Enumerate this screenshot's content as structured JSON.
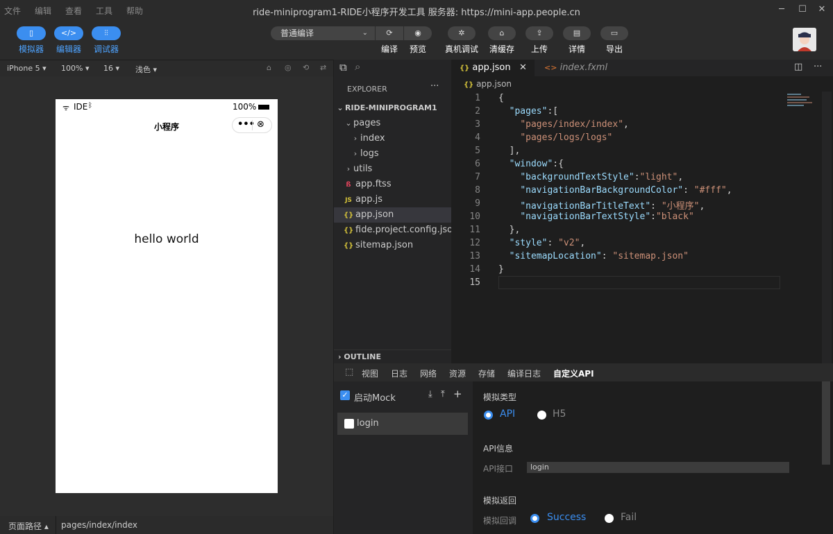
{
  "menu": [
    "文件",
    "编辑",
    "查看",
    "工具",
    "帮助"
  ],
  "window_title": "ride-miniprogram1-RIDE小程序开发工具 服务器: https://mini-app.people.cn",
  "toolbar": {
    "modes": [
      "模拟器",
      "编辑器",
      "调试器"
    ],
    "compile_mode": "普通编译",
    "compile_label": "编译",
    "preview_label": "预览",
    "actions": [
      "真机调试",
      "清缓存",
      "上传",
      "详情",
      "导出"
    ]
  },
  "simulator": {
    "device": "iPhone 5",
    "zoom": "100%",
    "font_size": "16",
    "theme": "浅色",
    "status_left": "IDE",
    "status_right": "100%",
    "nav_title": "小程序",
    "content": "hello world",
    "footer_label": "页面路径",
    "footer_path": "pages/index/index"
  },
  "explorer": {
    "header": "EXPLORER",
    "project": "RIDE-MINIPROGRAM1",
    "items": [
      {
        "label": "pages",
        "icon": ""
      },
      {
        "label": "index",
        "icon": ""
      },
      {
        "label": "logs",
        "icon": ""
      },
      {
        "label": "utils",
        "icon": ""
      },
      {
        "label": "app.ftss",
        "icon": "ftss-icon"
      },
      {
        "label": "app.js",
        "icon": "JS"
      },
      {
        "label": "app.json",
        "icon": "{}"
      },
      {
        "label": "fide.project.config.json",
        "icon": "{}"
      },
      {
        "label": "sitemap.json",
        "icon": "{}"
      }
    ],
    "outline": "OUTLINE"
  },
  "editor": {
    "tabs": [
      "app.json",
      "index.fxml"
    ],
    "breadcrumb": "app.json",
    "line_numbers": [
      "1",
      "2",
      "3",
      "4",
      "5",
      "6",
      "7",
      "8",
      "9",
      "10",
      "11",
      "12",
      "13",
      "14",
      "15"
    ]
  },
  "devtools": {
    "tabs": [
      "视图",
      "日志",
      "网络",
      "资源",
      "存储",
      "编译日志",
      "自定义API"
    ],
    "mock_toggle": "启动Mock",
    "mock_item": "login",
    "sim_type_title": "模拟类型",
    "sim_type_options": [
      "API",
      "H5"
    ],
    "api_info_title": "API信息",
    "api_field_label": "API接口",
    "api_field_value": "login",
    "sim_return_title": "模拟返回",
    "callback_label": "模拟回调",
    "callback_options": [
      "Success",
      "Fail"
    ]
  },
  "colors": {
    "accent": "#3b8ef0",
    "key": "#9cdcfe",
    "string": "#ce9178"
  }
}
